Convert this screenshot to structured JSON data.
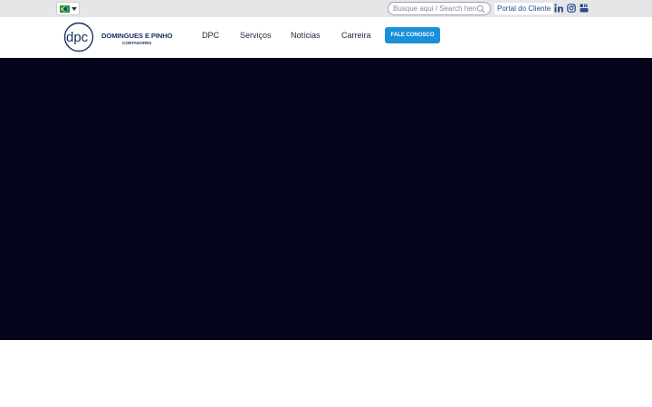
{
  "topbar": {
    "language_icon": "brazil-flag-icon",
    "search": {
      "placeholder": "Busque aqui / Search here",
      "icon": "search-icon"
    },
    "portal_label": "Portal do Cliente",
    "social_icons": [
      "linkedin-icon",
      "instagram-icon",
      "youtube-icon"
    ]
  },
  "header": {
    "logo": {
      "mark": "dpc",
      "title": "DOMINGUES E PINHO",
      "subtitle": "CONTADORES"
    },
    "nav": [
      "DPC",
      "Serviços",
      "Notícias",
      "Carreira"
    ],
    "cta_label": "FALE CONOSCO"
  },
  "colors": {
    "brand_navy": "#1a3264",
    "accent_blue": "#1b8fd8",
    "hero_background": "#03041a",
    "topbar_background": "#e6e6e8"
  }
}
